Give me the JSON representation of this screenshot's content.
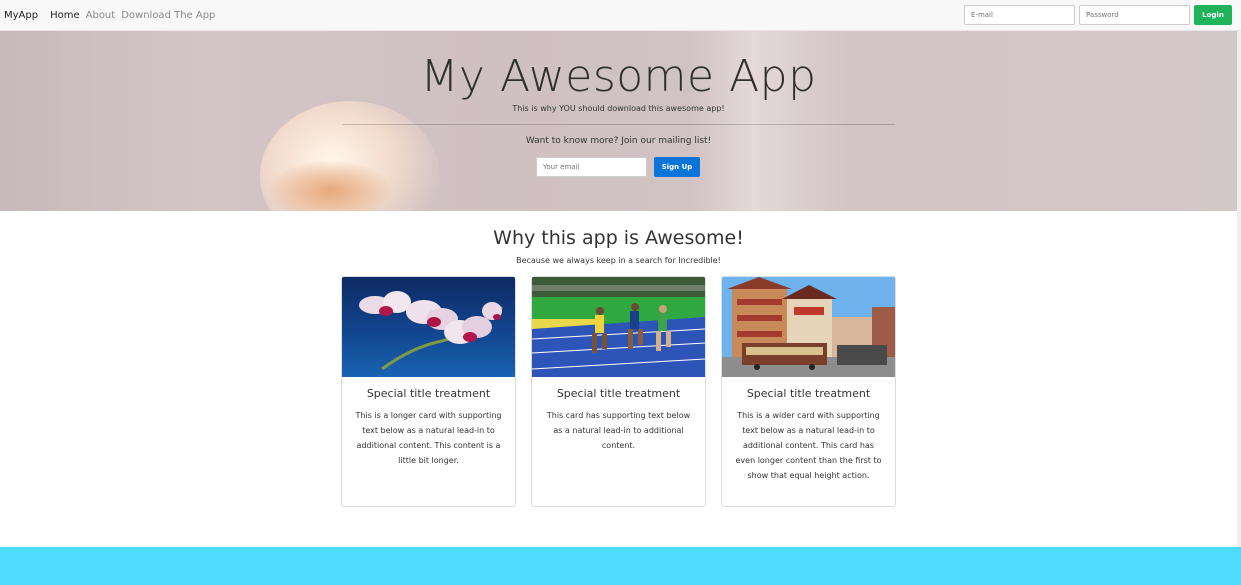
{
  "navbar": {
    "brand": "MyApp",
    "links": [
      "Home",
      "About",
      "Download The App"
    ],
    "email_placeholder": "E-mail",
    "password_placeholder": "Password",
    "login_label": "Login"
  },
  "hero": {
    "title": "My Awesome App",
    "subtitle": "This is why YOU should download this awesome app!",
    "cta_text": "Want to know more? Join our mailing list!",
    "email_placeholder": "Your email",
    "signup_label": "Sign Up"
  },
  "features": {
    "title": "Why this app is Awesome!",
    "subtitle": "Because we always keep in a search for Incredible!",
    "cards": [
      {
        "title": "Special title treatment",
        "text": "This is a longer card with supporting text below as a natural lead-in to additional content. This content is a little bit longer.",
        "image": "orchid-photo"
      },
      {
        "title": "Special title treatment",
        "text": "This card has supporting text below as a natural lead-in to additional content.",
        "image": "sprinters-photo"
      },
      {
        "title": "Special title treatment",
        "text": "This is a wider card with supporting text below as a natural lead-in to additional content. This card has even longer content than the first to show that equal height action.",
        "image": "chinatown-cable-car-photo"
      }
    ]
  },
  "colors": {
    "login_button": "#1fb45a",
    "signup_button": "#0b74d8",
    "footer_band": "#4ddcff"
  }
}
